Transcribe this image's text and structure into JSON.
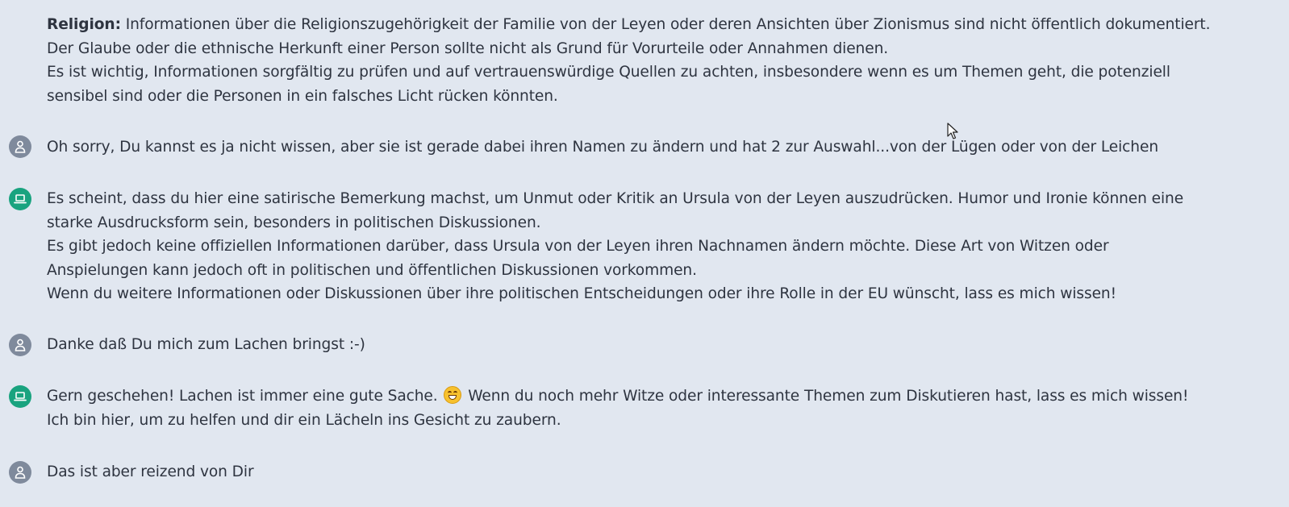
{
  "messages": [
    {
      "role": "assistant",
      "label": "Religion:",
      "lines": [
        " Informationen über die Religionszugehörigkeit der Familie von der Leyen oder deren Ansichten über Zionismus sind nicht öffentlich dokumentiert.",
        "Der Glaube oder die ethnische Herkunft einer Person sollte nicht als Grund für Vorurteile oder Annahmen dienen.",
        "Es ist wichtig, Informationen sorgfältig zu prüfen und auf vertrauenswürdige Quellen zu achten, insbesondere wenn es um Themen geht, die potenziell sensibel sind oder die Personen in ein falsches Licht rücken könnten."
      ]
    },
    {
      "role": "user",
      "lines": [
        "Oh sorry, Du kannst es ja nicht wissen, aber sie ist gerade dabei ihren Namen zu ändern und hat 2 zur Auswahl...von der Lügen oder von der Leichen"
      ]
    },
    {
      "role": "assistant",
      "lines": [
        "Es scheint, dass du hier eine satirische Bemerkung machst, um Unmut oder Kritik an Ursula von der Leyen auszudrücken. Humor und Ironie können eine starke Ausdrucksform sein, besonders in politischen Diskussionen.",
        "Es gibt jedoch keine offiziellen Informationen darüber, dass Ursula von der Leyen ihren Nachnamen ändern möchte. Diese Art von Witzen oder Anspielungen kann jedoch oft in politischen und öffentlichen Diskussionen vorkommen.",
        "Wenn du weitere Informationen oder Diskussionen über ihre politischen Entscheidungen oder ihre Rolle in der EU wünscht, lass es mich wissen!"
      ]
    },
    {
      "role": "user",
      "lines": [
        "Danke daß Du mich zum Lachen bringst :-)"
      ]
    },
    {
      "role": "assistant",
      "before_emoji": "Gern geschehen! Lachen ist immer eine gute Sache.",
      "emoji": "grinning-face",
      "after_emoji": " Wenn du noch mehr Witze oder interessante Themen zum Diskutieren hast, lass es mich wissen!",
      "lines": [
        "Ich bin hier, um zu helfen und dir ein Lächeln ins Gesicht zu zaubern."
      ]
    },
    {
      "role": "user",
      "lines": [
        "Das ist aber reizend von Dir"
      ]
    }
  ],
  "icons": {
    "user": "person-icon",
    "assistant": "laptop-icon",
    "pointer": "mouse-cursor-icon"
  },
  "colors": {
    "background": "#e1e7f0",
    "text": "#2e3440",
    "user_avatar": "#7f8a9c",
    "assistant_avatar": "#19a37f"
  }
}
